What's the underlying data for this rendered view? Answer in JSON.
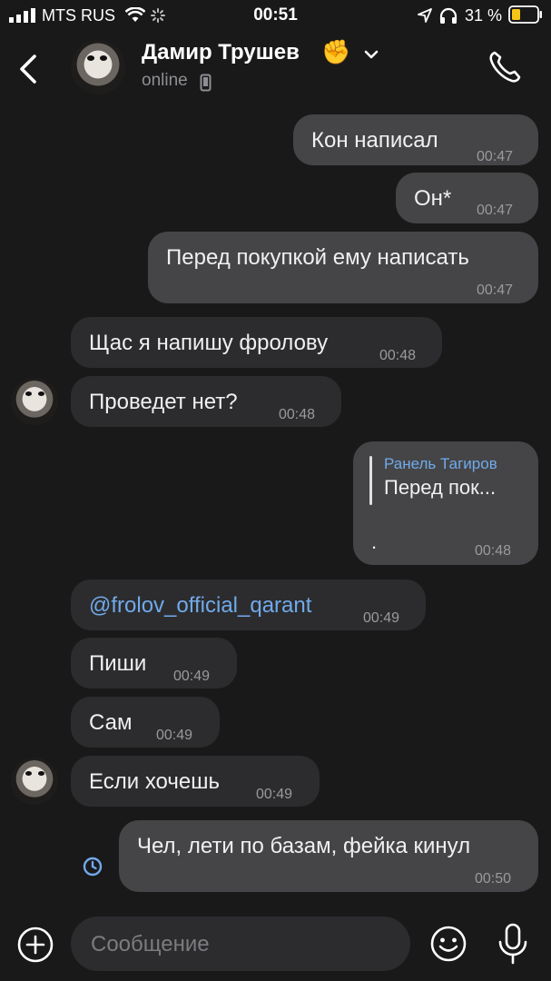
{
  "status_bar": {
    "carrier": "MTS RUS",
    "time": "00:51",
    "battery": "31 %"
  },
  "header": {
    "contact_name": "Дамир Трушев",
    "name_emoji": "✊",
    "presence": "online"
  },
  "messages": [
    {
      "direction": "out",
      "text": "Кон написал",
      "time": "00:47"
    },
    {
      "direction": "out",
      "text": "Он*",
      "time": "00:47"
    },
    {
      "direction": "out",
      "text": "Перед покупкой ему написать",
      "time": "00:47"
    },
    {
      "direction": "in",
      "text": "Щас я напишу фролову",
      "time": "00:48"
    },
    {
      "direction": "in",
      "text": "Проведет нет?",
      "time": "00:48"
    },
    {
      "direction": "out",
      "reply_to_name": "Ранель Тагиров",
      "reply_to_text": "Перед пок...",
      "text": ".",
      "time": "00:48"
    },
    {
      "direction": "in",
      "text": "@frolov_official_qarant",
      "time": "00:49",
      "is_mention": true
    },
    {
      "direction": "in",
      "text": "Пиши",
      "time": "00:49"
    },
    {
      "direction": "in",
      "text": "Сам",
      "time": "00:49"
    },
    {
      "direction": "in",
      "text": "Если хочешь",
      "time": "00:49"
    },
    {
      "direction": "out",
      "text": "Чел, лети по базам, фейка кинул",
      "time": "00:50",
      "status_icon": "clock-icon"
    }
  ],
  "composer": {
    "placeholder": "Сообщение"
  },
  "icons": {
    "back": "chevron-left-icon",
    "call": "phone-icon",
    "attach": "plus-circle-icon",
    "emoji": "smile-icon",
    "voice": "microphone-icon"
  },
  "colors": {
    "background": "#19191a",
    "outgoing_bubble": "#454547",
    "incoming_bubble": "#2c2c2e",
    "accent": "#71aaeb",
    "battery": "#f5c518"
  }
}
